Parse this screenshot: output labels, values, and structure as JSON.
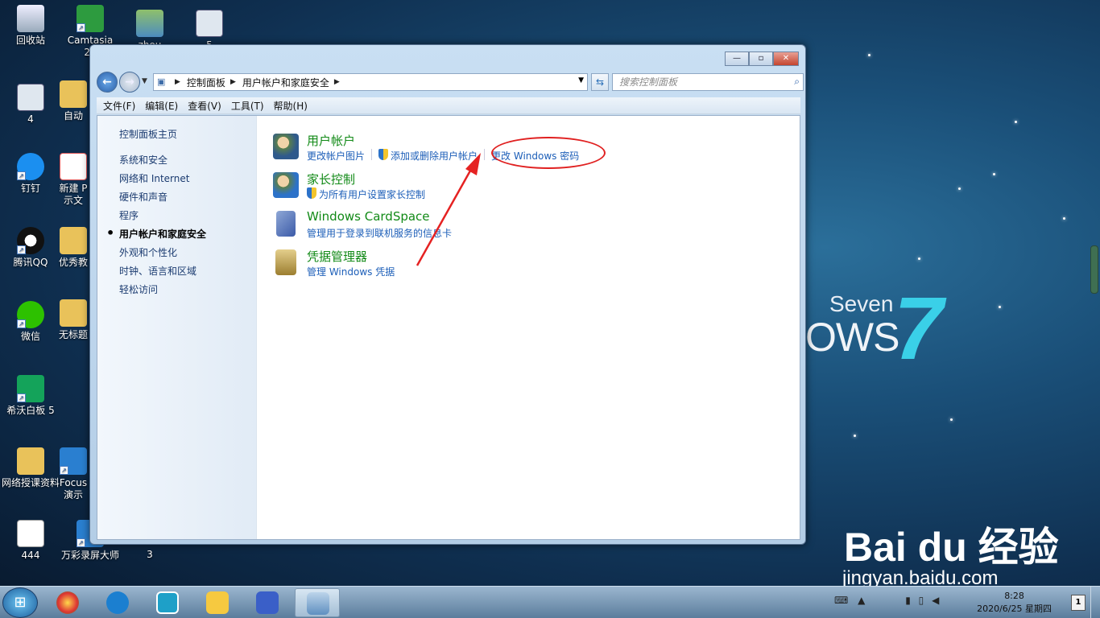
{
  "desktop": {
    "icons": [
      {
        "label": "回收站"
      },
      {
        "label": "Camtasia 20"
      },
      {
        "label": "zhou"
      },
      {
        "label": "5"
      },
      {
        "label": "4"
      },
      {
        "label": "自动"
      },
      {
        "label": "钉钉"
      },
      {
        "label": "新建 P 示文"
      },
      {
        "label": "腾讯QQ"
      },
      {
        "label": "优秀教"
      },
      {
        "label": "微信"
      },
      {
        "label": "无标题"
      },
      {
        "label": "希沃白板 5"
      },
      {
        "label": "网络授课资料"
      },
      {
        "label": "Focus 演示"
      },
      {
        "label": "444"
      },
      {
        "label": "万彩录屏大师"
      },
      {
        "label": "3"
      }
    ],
    "watermark": {
      "seven": "Seven",
      "ows": "OWS",
      "num": "7",
      "baidu": "Bai du 经验",
      "baidu_sub": "jingyan.baidu.com"
    }
  },
  "window": {
    "controls": {
      "minimize": "—",
      "maximize": "▫",
      "close": "✕"
    },
    "breadcrumbs": [
      "控制面板",
      "用户帐户和家庭安全"
    ],
    "search_placeholder": "搜索控制面板",
    "menu": [
      "文件(F)",
      "编辑(E)",
      "查看(V)",
      "工具(T)",
      "帮助(H)"
    ],
    "left_pane": {
      "home": "控制面板主页",
      "items": [
        "系统和安全",
        "网络和 Internet",
        "硬件和声音",
        "程序",
        "用户帐户和家庭安全",
        "外观和个性化",
        "时钟、语言和区域",
        "轻松访问"
      ],
      "active_index": 4
    },
    "categories": [
      {
        "title": "用户帐户",
        "links": [
          "更改帐户图片",
          "添加或删除用户帐户",
          "更改 Windows 密码"
        ]
      },
      {
        "title": "家长控制",
        "links": [
          "为所有用户设置家长控制"
        ]
      },
      {
        "title": "Windows CardSpace",
        "links": [
          "管理用于登录到联机服务的信息卡"
        ]
      },
      {
        "title": "凭据管理器",
        "links": [
          "管理 Windows 凭据"
        ]
      }
    ]
  },
  "taskbar": {
    "time": "8:28",
    "date": "2020/6/25 星期四"
  }
}
